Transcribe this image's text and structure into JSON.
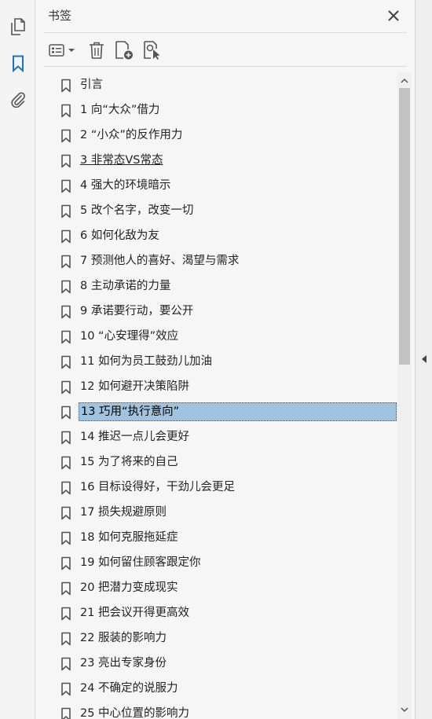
{
  "panel": {
    "title": "书签",
    "close_icon": "close-icon"
  },
  "rail": {
    "icons": [
      "pages-icon",
      "bookmark-icon",
      "attachment-icon"
    ],
    "active": "bookmark-icon"
  },
  "toolbar": {
    "icons": [
      "options-menu-icon",
      "delete-icon",
      "new-bookmark-icon",
      "bookmark-from-selection-icon"
    ]
  },
  "colors": {
    "accent": "#1a73c8",
    "selected_bg": "#a0c4e0",
    "icon": "#555555"
  },
  "bookmarks": [
    {
      "label": "引言"
    },
    {
      "label": "1 向“大众”借力"
    },
    {
      "label": "2 “小众”的反作用力"
    },
    {
      "label": "3 非常态VS常态",
      "underline": true
    },
    {
      "label": "4 强大的环境暗示"
    },
    {
      "label": "5 改个名字，改变一切"
    },
    {
      "label": "6 如何化敌为友"
    },
    {
      "label": "7 预测他人的喜好、渴望与需求"
    },
    {
      "label": "8 主动承诺的力量"
    },
    {
      "label": "9 承诺要行动，要公开"
    },
    {
      "label": "10 “心安理得”效应"
    },
    {
      "label": "11 如何为员工鼓劲儿加油"
    },
    {
      "label": "12 如何避开决策陷阱"
    },
    {
      "label": "13 巧用“执行意向”",
      "selected": true
    },
    {
      "label": "14 推迟一点儿会更好"
    },
    {
      "label": "15 为了将来的自己"
    },
    {
      "label": "16 目标设得好，干劲儿会更足"
    },
    {
      "label": "17 损失规避原则"
    },
    {
      "label": "18 如何克服拖延症"
    },
    {
      "label": "19 如何留住顾客跟定你"
    },
    {
      "label": "20 把潜力变成现实"
    },
    {
      "label": "21 把会议开得更高效"
    },
    {
      "label": "22 服装的影响力"
    },
    {
      "label": "23 亮出专家身份"
    },
    {
      "label": "24 不确定的说服力"
    },
    {
      "label": "25 中心位置的影响力"
    }
  ]
}
